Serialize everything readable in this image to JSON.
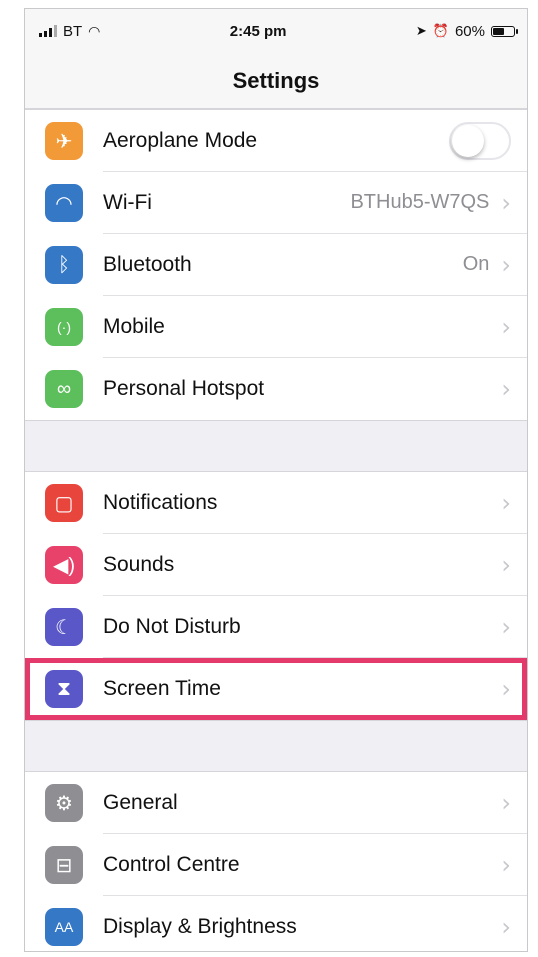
{
  "status": {
    "carrier": "BT",
    "time": "2:45 pm",
    "battery": "60%",
    "battery_level": 0.6
  },
  "nav": {
    "title": "Settings"
  },
  "groups": [
    [
      {
        "label": "Aeroplane Mode",
        "icon": "airplane-icon",
        "color": "#f19a37",
        "toggle": "off"
      },
      {
        "label": "Wi-Fi",
        "icon": "wifi-icon",
        "color": "#3478c6",
        "value": "BTHub5-W7QS"
      },
      {
        "label": "Bluetooth",
        "icon": "bluetooth-icon",
        "color": "#3478c6",
        "value": "On"
      },
      {
        "label": "Mobile",
        "icon": "antenna-icon",
        "color": "#5cbf5c"
      },
      {
        "label": "Personal Hotspot",
        "icon": "hotspot-link-icon",
        "color": "#5cbf5c"
      }
    ],
    [
      {
        "label": "Notifications",
        "icon": "notifications-icon",
        "color": "#e8453c"
      },
      {
        "label": "Sounds",
        "icon": "speaker-icon",
        "color": "#e8416a"
      },
      {
        "label": "Do Not Disturb",
        "icon": "moon-icon",
        "color": "#5a57c8"
      },
      {
        "label": "Screen Time",
        "icon": "hourglass-icon",
        "color": "#5a57c8",
        "highlighted": true
      }
    ],
    [
      {
        "label": "General",
        "icon": "gear-icon",
        "color": "#8e8e93"
      },
      {
        "label": "Control Centre",
        "icon": "switches-icon",
        "color": "#8e8e93"
      },
      {
        "label": "Display & Brightness",
        "icon": "text-size-icon",
        "color": "#3478c6"
      }
    ]
  ],
  "icon_glyphs": {
    "airplane": "✈",
    "wifi": "◠",
    "bluetooth": "ᛒ",
    "antenna": "(·)",
    "hotspot": "∞",
    "notifications": "▢",
    "sounds": "◀)",
    "moon": "☾",
    "hourglass": "⧗",
    "gear": "⚙",
    "switches": "⊟",
    "text_size": "AA"
  }
}
